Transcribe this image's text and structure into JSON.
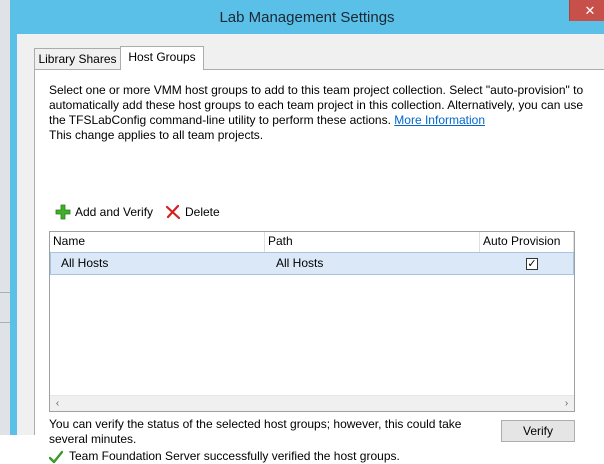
{
  "window": {
    "title": "Lab Management Settings",
    "close_glyph": "✕"
  },
  "tabs": [
    {
      "label": "Library Shares",
      "active": false
    },
    {
      "label": "Host Groups",
      "active": true
    }
  ],
  "description": {
    "text": "Select one or more VMM host groups to add to this team project collection. Select \"auto-provision\" to automatically add these host groups to each team project in this collection. Alternatively, you can use the TFSLabConfig command-line utility to perform these actions.",
    "link": "More Information",
    "line2": "This change applies to all team projects."
  },
  "toolbar": {
    "add_label": "Add and Verify",
    "add_icon": "plus-icon",
    "delete_label": "Delete",
    "delete_icon": "red-x-icon"
  },
  "grid": {
    "columns": [
      "Name",
      "Path",
      "Auto Provision"
    ],
    "rows": [
      {
        "name": "All Hosts",
        "path": "All Hosts",
        "auto_provision": true
      }
    ],
    "check_glyph": "✓",
    "scroll_left": "‹",
    "scroll_right": "›"
  },
  "footer": {
    "note": "You can verify the status of the selected host groups; however, this could take several minutes.",
    "verify_label": "Verify",
    "status": "Team Foundation Server successfully verified the host groups.",
    "status_icon": "checkmark-icon"
  },
  "colors": {
    "title_bar": "#5bc0e8",
    "close": "#c7504a",
    "selection": "#dbe8f7",
    "link": "#0066cc"
  }
}
